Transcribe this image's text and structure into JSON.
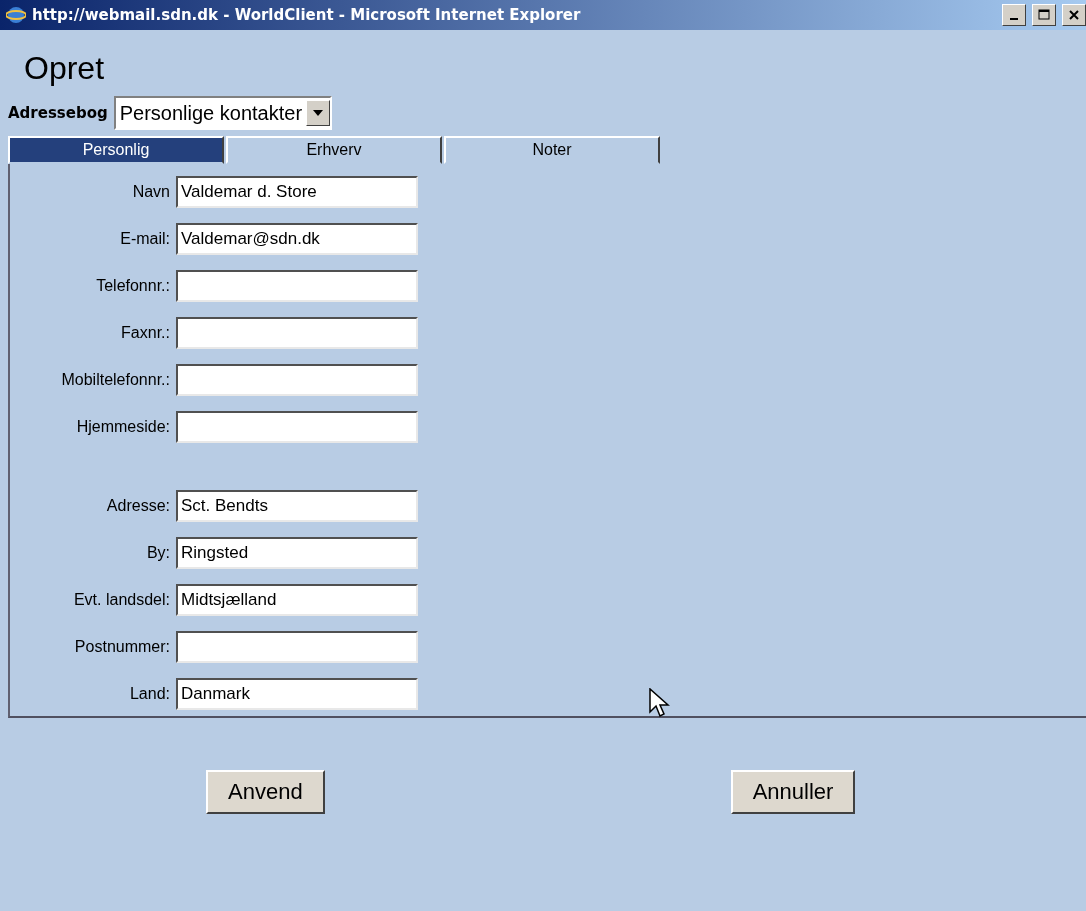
{
  "window": {
    "title": "http://webmail.sdn.dk - WorldClient - Microsoft Internet Explorer"
  },
  "heading": "Opret",
  "addressbook": {
    "label": "Adressebog",
    "value": "Personlige kontakter"
  },
  "tabs": [
    {
      "label": "Personlig",
      "selected": true
    },
    {
      "label": "Erhverv",
      "selected": false
    },
    {
      "label": "Noter",
      "selected": false
    }
  ],
  "field_groups": [
    [
      {
        "label": "Navn",
        "value": "Valdemar d. Store"
      },
      {
        "label": "E-mail:",
        "value": "Valdemar@sdn.dk"
      },
      {
        "label": "Telefonnr.:"
      },
      {
        "label": "Faxnr.:"
      },
      {
        "label": "Mobiltelefonnr.:"
      },
      {
        "label": "Hjemmeside:"
      }
    ],
    [
      {
        "label": "Adresse:",
        "value": "Sct. Bendts"
      },
      {
        "label": "By:",
        "value": "Ringsted"
      },
      {
        "label": "Evt. landsdel:",
        "value": "Midtsjælland"
      },
      {
        "label": "Postnummer:"
      },
      {
        "label": "Land:",
        "value": "Danmark"
      }
    ]
  ],
  "buttons": [
    "Anvend",
    "Annuller"
  ]
}
